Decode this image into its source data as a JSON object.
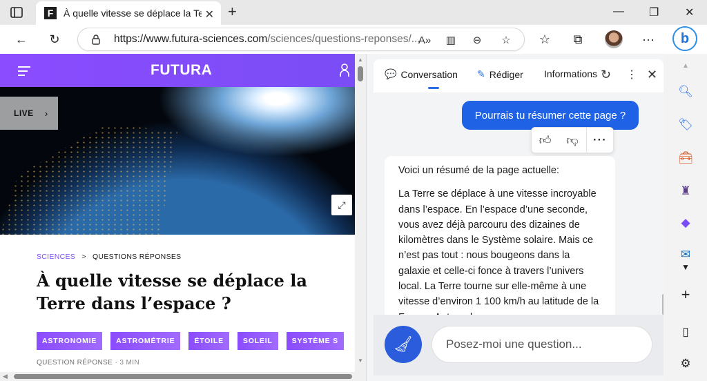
{
  "browser": {
    "tab": {
      "favicon": "F",
      "title": "À quelle vitesse se déplace la Terre"
    },
    "new_tab": "+",
    "window": {
      "minimize": "—",
      "restore": "❐",
      "close": "✕"
    },
    "url_main": "https://www.futura-sciences.com",
    "url_rest": "/sciences/questions-reponses/...",
    "icons": [
      "tab-actions-icon",
      "back-icon",
      "refresh-icon",
      "lock-icon",
      "read-aloud-icon",
      "immersive-reader-icon",
      "zoom-icon",
      "add-favorite-icon",
      "favorites-icon",
      "collections-icon",
      "profile-avatar",
      "more-icon",
      "bing-chat-icon"
    ]
  },
  "page": {
    "logo": "FUTURA",
    "live_label": "LIVE",
    "breadcrumb": {
      "category": "SCIENCES",
      "sep": ">",
      "subcategory": "QUESTIONS RÉPONSES"
    },
    "title": "À quelle vitesse se déplace la Terre dans l’espace ?",
    "tags": [
      "ASTRONOMIE",
      "ASTROMÉTRIE",
      "ÉTOILE",
      "SOLEIL",
      "SYSTÈME S"
    ],
    "meta": {
      "type": "QUESTION RÉPONSE",
      "read_time": " · 3 MIN"
    }
  },
  "chat": {
    "tabs": [
      {
        "label": "Conversation",
        "icon": "chat-icon"
      },
      {
        "label": "Rédiger",
        "icon": "compose-icon"
      },
      {
        "label": "Informations",
        "icon": ""
      }
    ],
    "user_message": "Pourrais tu résumer cette page ?",
    "bot_intro": "Voici un résumé de la page actuelle:",
    "bot_body": "La Terre se déplace à une vitesse incroyable dans l’espace. En l’espace d’une seconde, vous avez déjà parcouru des dizaines de kilomètres dans le Système solaire. Mais ce n’est pas tout : nous bougeons dans la galaxie et celle-ci fonce à travers l’univers local. La Terre tourne sur elle-même à une vitesse d’environ 1 100 km/h au latitude de la France. Autour du",
    "input_placeholder": "Posez-moi une question..."
  },
  "colors": {
    "accent": "#1f62e6",
    "futura_purple": "#7a4df5"
  }
}
